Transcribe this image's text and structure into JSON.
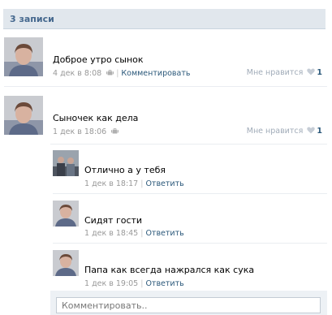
{
  "header": {
    "title": "3 записи"
  },
  "posts": [
    {
      "text": "Доброе утро сынок",
      "date": "4 дек в 8:08",
      "comment_label": "Комментировать",
      "like_label": "Мне нравится",
      "like_count": "1"
    },
    {
      "text": "Сыночек как дела",
      "date": "1 дек в 18:06",
      "like_label": "Мне нравится",
      "like_count": "1"
    }
  ],
  "comments": [
    {
      "text": "Отлично а у тебя",
      "date": "1 дек в 18:17",
      "reply_label": "Ответить"
    },
    {
      "text": "Сидят гости",
      "date": "1 дек в 18:45",
      "reply_label": "Ответить"
    },
    {
      "text": "Папа как всегда нажрался как сука",
      "date": "1 дек в 19:05",
      "reply_label": "Ответить"
    }
  ],
  "comment_input": {
    "placeholder": "Комментировать.."
  },
  "colors": {
    "link": "#2b587a",
    "header_bg": "#e1e7ed",
    "header_text": "#45688e"
  },
  "icons": {
    "platform": "android-icon",
    "like": "heart-icon"
  }
}
